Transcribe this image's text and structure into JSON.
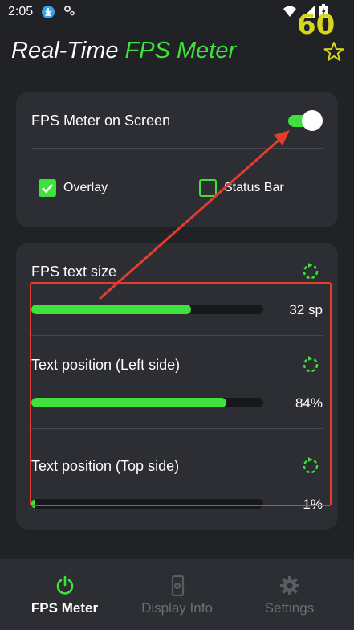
{
  "status_bar": {
    "time": "2:05",
    "icons": [
      "download-icon",
      "settings-gear-icon",
      "wifi-icon",
      "signal-icon",
      "battery-charging-icon"
    ]
  },
  "fps_overlay": {
    "value": "60"
  },
  "header": {
    "title_part1": "Real-Time ",
    "title_part2": "FPS Meter",
    "star_icon": "star-outline-icon"
  },
  "card_display": {
    "toggle_label": "FPS Meter on Screen",
    "toggle_on": true,
    "overlay_label": "Overlay",
    "overlay_checked": true,
    "status_bar_label": "Status Bar",
    "status_bar_checked": false
  },
  "card_sliders": {
    "text_size": {
      "label": "FPS text size",
      "value_text": "32 sp",
      "fill_fraction": 0.69
    },
    "left_position": {
      "label": "Text position (Left side)",
      "value_text": "84%",
      "fill_fraction": 0.84
    },
    "top_position": {
      "label": "Text position (Top side)",
      "value_text": "1%",
      "fill_fraction": 0.01
    }
  },
  "bottom_nav": {
    "items": [
      {
        "label": "FPS Meter",
        "icon": "power-icon",
        "active": true
      },
      {
        "label": "Display Info",
        "icon": "phone-gear-icon",
        "active": false
      },
      {
        "label": "Settings",
        "icon": "gear-icon",
        "active": false
      }
    ]
  },
  "colors": {
    "accent": "#3fe23c",
    "background": "#202226",
    "card": "#2c2e33",
    "fps_overlay": "#d8d61c",
    "annotation": "#e53c2e"
  }
}
